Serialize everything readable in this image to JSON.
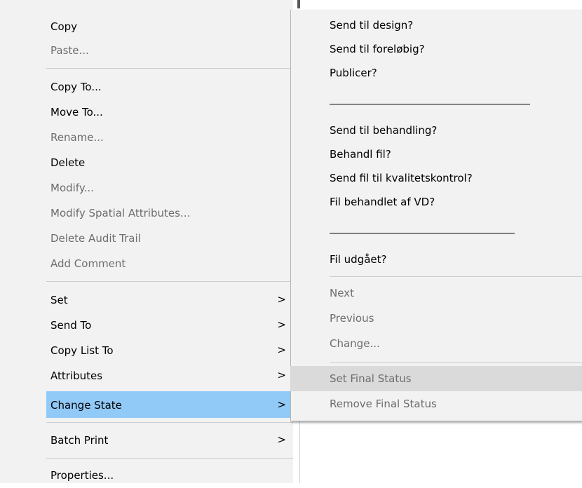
{
  "context_menu": {
    "items": [
      {
        "label": "Copy",
        "enabled": true
      },
      {
        "label": "Paste...",
        "enabled": false
      },
      {
        "label": "Copy To...",
        "enabled": true
      },
      {
        "label": "Move To...",
        "enabled": true
      },
      {
        "label": "Rename...",
        "enabled": false
      },
      {
        "label": "Delete",
        "enabled": true
      },
      {
        "label": "Modify...",
        "enabled": false
      },
      {
        "label": "Modify Spatial Attributes...",
        "enabled": false
      },
      {
        "label": "Delete Audit Trail",
        "enabled": false
      },
      {
        "label": "Add Comment",
        "enabled": false
      },
      {
        "label": "Set",
        "enabled": true,
        "submenu_arrow": ">"
      },
      {
        "label": "Send To",
        "enabled": true,
        "submenu_arrow": ">"
      },
      {
        "label": "Copy List To",
        "enabled": true,
        "submenu_arrow": ">"
      },
      {
        "label": "Attributes",
        "enabled": true,
        "submenu_arrow": ">"
      },
      {
        "label": "Change State",
        "enabled": true,
        "submenu_arrow": ">",
        "highlighted": true
      },
      {
        "label": "Batch Print",
        "enabled": true,
        "submenu_arrow": ">"
      },
      {
        "label": "Properties...",
        "enabled": true
      }
    ]
  },
  "change_state_submenu": {
    "items": [
      {
        "label": "Send til design?",
        "enabled": true
      },
      {
        "label": "Send til foreløbig?",
        "enabled": true
      },
      {
        "label": "Publicer?",
        "enabled": true
      },
      {
        "label": "Send til behandling?",
        "enabled": true
      },
      {
        "label": "Behandl fil?",
        "enabled": true
      },
      {
        "label": "Send fil til kvalitetskontrol?",
        "enabled": true
      },
      {
        "label": "Fil behandlet af VD?",
        "enabled": true
      },
      {
        "label": "Fil udgået?",
        "enabled": true
      },
      {
        "label": "Next",
        "enabled": false
      },
      {
        "label": "Previous",
        "enabled": false
      },
      {
        "label": "Change...",
        "enabled": false
      },
      {
        "label": "Set Final Status",
        "enabled": false,
        "hovered": true
      },
      {
        "label": "Remove Final Status",
        "enabled": false
      }
    ]
  },
  "colors": {
    "menu_background": "#f2f2f2",
    "highlight": "#91c9f7",
    "hover": "#dadada",
    "disabled_text": "#6d6d6d"
  }
}
